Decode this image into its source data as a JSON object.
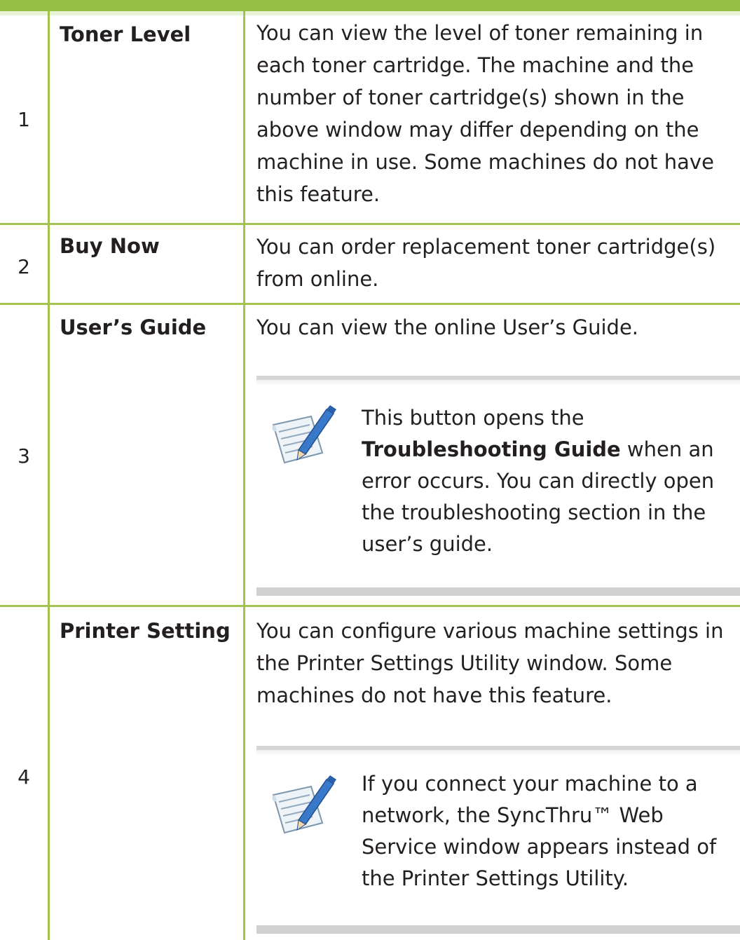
{
  "rows": [
    {
      "number": "1",
      "name": "Toner Level",
      "description": "You can view the level of toner remaining in each toner cartridge. The machine and the number of toner cartridge(s) shown in the above window may differ depending on the machine in use. Some machines do not have this feature."
    },
    {
      "number": "2",
      "name": "Buy Now",
      "description": "You can order replacement toner cartridge(s) from online."
    },
    {
      "number": "3",
      "name": "User’s Guide",
      "description": "You can view the online User’s Guide.",
      "note": {
        "icon": "note-pencil-icon",
        "text_before": "This button opens the ",
        "text_bold": "Troubleshooting Guide",
        "text_after": " when an error occurs. You can directly open the troubleshooting section in the user’s guide."
      }
    },
    {
      "number": "4",
      "name": "Printer Setting",
      "description": "You can configure various machine settings in the Printer Settings Utility window. Some machines do not have this feature.",
      "note": {
        "icon": "note-pencil-icon",
        "text": "If you connect your machine to a network, the SyncThru™ Web Service window appears instead of the Printer Settings Utility."
      }
    }
  ],
  "colors": {
    "rule": "#a2c44e",
    "header_bar": "#93c044",
    "text": "#231f20"
  }
}
